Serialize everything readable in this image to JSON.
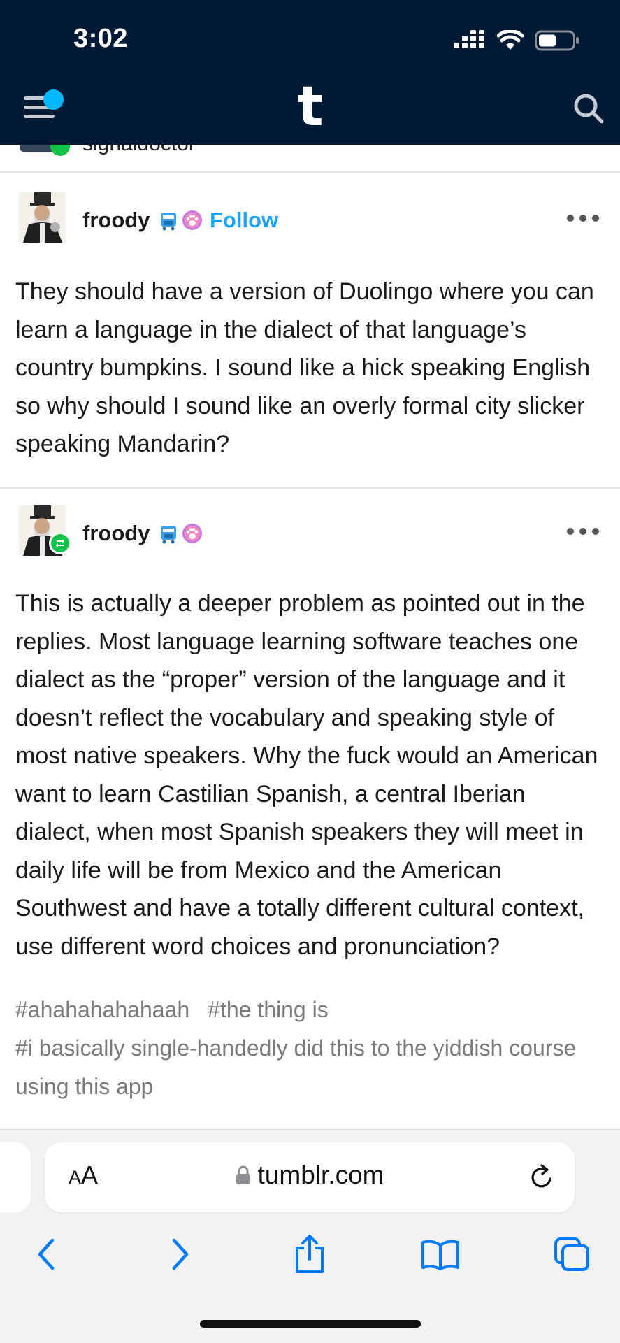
{
  "status_bar": {
    "time": "3:02"
  },
  "app": {
    "logo": "t"
  },
  "previous_post": {
    "text": "signaldoctor"
  },
  "posts": [
    {
      "blog_name": "froody",
      "follow_label": "Follow",
      "body": "They should have a version of Duolingo where you can learn a language in the dialect of that language’s country bumpkins. I sound like a hick speaking English so why should I sound like an overly formal city slicker speaking Mandarin?"
    },
    {
      "blog_name": "froody",
      "body": "This is actually a deeper problem as pointed out in the replies. Most language learning software teaches one dialect as the “proper” version of the language and it doesn’t reflect the vocabulary and speaking style of most native speakers. Why the fuck would an American want to learn Castilian Spanish, a central Iberian dialect, when most Spanish speakers they will meet in daily life will be from Mexico and the American Southwest and have a totally different cultural context, use different word choices and pronunciation?",
      "tags": [
        "#ahahahahahaah",
        "#the thing is",
        "#i basically single-handedly did this to the yiddish course using this app"
      ]
    }
  ],
  "browser": {
    "text_size_label_large": "A",
    "text_size_label_small": "A",
    "url": "tumblr.com"
  },
  "colors": {
    "header_bg": "#001935",
    "accent_blue": "#1aa3ff",
    "notification_dot": "#00b8ff",
    "reblog_green": "#13c248",
    "ios_blue": "#007aff"
  }
}
